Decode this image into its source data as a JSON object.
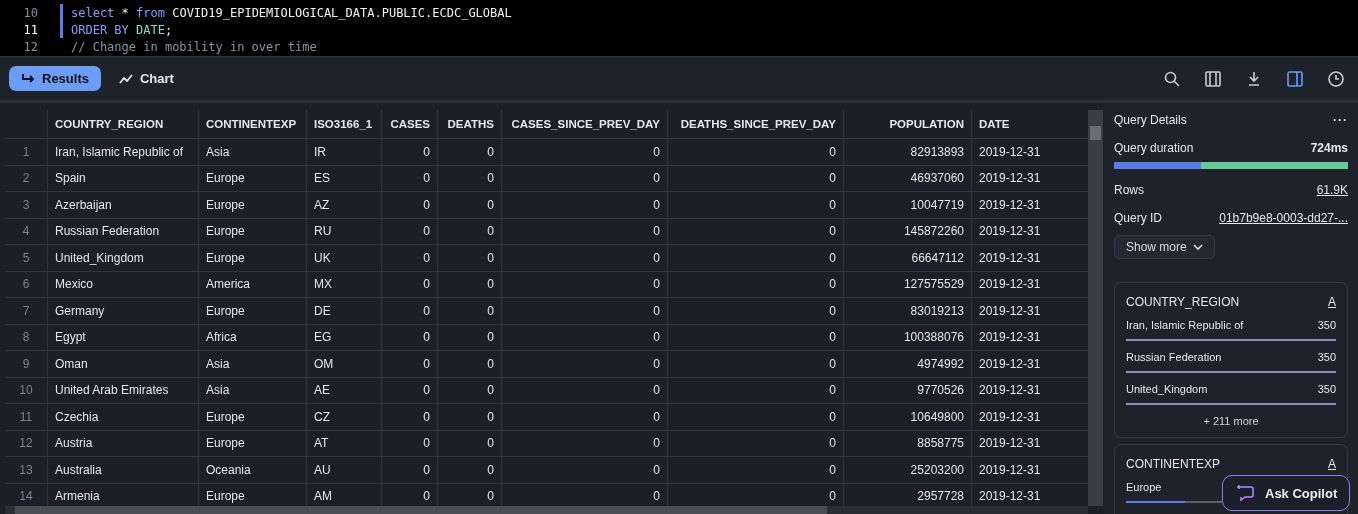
{
  "editor": {
    "lines": [
      {
        "number": "10",
        "current": false,
        "tokens": [
          {
            "kind": "kw",
            "text": "select"
          },
          {
            "kind": "op",
            "text": " * "
          },
          {
            "kind": "kw",
            "text": "from"
          },
          {
            "kind": "id",
            "text": " COVID19_EPIDEMIOLOGICAL_DATA.PUBLIC.ECDC_GLOBAL"
          }
        ]
      },
      {
        "number": "11",
        "current": true,
        "tokens": [
          {
            "kind": "kw",
            "text": "ORDER BY "
          },
          {
            "kind": "fn",
            "text": "DATE"
          },
          {
            "kind": "id",
            "text": ";"
          }
        ]
      },
      {
        "number": "12",
        "current": false,
        "tokens": [
          {
            "kind": "comment",
            "text": "// Change in mobility in over time"
          }
        ]
      }
    ]
  },
  "tabs": [
    {
      "label": "Results",
      "selected": true
    },
    {
      "label": "Chart",
      "selected": false
    }
  ],
  "toolbar": [
    {
      "kind": "search",
      "selected": false
    },
    {
      "kind": "columns",
      "selected": false
    },
    {
      "kind": "download",
      "selected": false
    },
    {
      "kind": "panel",
      "selected": true
    },
    {
      "kind": "history",
      "selected": false
    }
  ],
  "table": {
    "columns": [
      "COUNTRY_REGION",
      "CONTINENTEXP",
      "ISO3166_1",
      "CASES",
      "DEATHS",
      "CASES_SINCE_PREV_DAY",
      "DEATHS_SINCE_PREV_DAY",
      "POPULATION",
      "DATE"
    ],
    "rows": [
      {
        "number": "1",
        "cells": [
          "Iran, Islamic Republic of",
          "Asia",
          "IR",
          "0",
          "0",
          "0",
          "0",
          "82913893",
          "2019-12-31"
        ]
      },
      {
        "number": "2",
        "cells": [
          "Spain",
          "Europe",
          "ES",
          "0",
          "0",
          "0",
          "0",
          "46937060",
          "2019-12-31"
        ]
      },
      {
        "number": "3",
        "cells": [
          "Azerbaijan",
          "Europe",
          "AZ",
          "0",
          "0",
          "0",
          "0",
          "10047719",
          "2019-12-31"
        ]
      },
      {
        "number": "4",
        "cells": [
          "Russian Federation",
          "Europe",
          "RU",
          "0",
          "0",
          "0",
          "0",
          "145872260",
          "2019-12-31"
        ]
      },
      {
        "number": "5",
        "cells": [
          "United_Kingdom",
          "Europe",
          "UK",
          "0",
          "0",
          "0",
          "0",
          "66647112",
          "2019-12-31"
        ]
      },
      {
        "number": "6",
        "cells": [
          "Mexico",
          "America",
          "MX",
          "0",
          "0",
          "0",
          "0",
          "127575529",
          "2019-12-31"
        ]
      },
      {
        "number": "7",
        "cells": [
          "Germany",
          "Europe",
          "DE",
          "0",
          "0",
          "0",
          "0",
          "83019213",
          "2019-12-31"
        ]
      },
      {
        "number": "8",
        "cells": [
          "Egypt",
          "Africa",
          "EG",
          "0",
          "0",
          "0",
          "0",
          "100388076",
          "2019-12-31"
        ]
      },
      {
        "number": "9",
        "cells": [
          "Oman",
          "Asia",
          "OM",
          "0",
          "0",
          "0",
          "0",
          "4974992",
          "2019-12-31"
        ]
      },
      {
        "number": "10",
        "cells": [
          "United Arab Emirates",
          "Asia",
          "AE",
          "0",
          "0",
          "0",
          "0",
          "9770526",
          "2019-12-31"
        ]
      },
      {
        "number": "11",
        "cells": [
          "Czechia",
          "Europe",
          "CZ",
          "0",
          "0",
          "0",
          "0",
          "10649800",
          "2019-12-31"
        ]
      },
      {
        "number": "12",
        "cells": [
          "Austria",
          "Europe",
          "AT",
          "0",
          "0",
          "0",
          "0",
          "8858775",
          "2019-12-31"
        ]
      },
      {
        "number": "13",
        "cells": [
          "Australia",
          "Oceania",
          "AU",
          "0",
          "0",
          "0",
          "0",
          "25203200",
          "2019-12-31"
        ]
      },
      {
        "number": "14",
        "cells": [
          "Armenia",
          "Europe",
          "AM",
          "0",
          "0",
          "0",
          "0",
          "2957728",
          "2019-12-31"
        ]
      }
    ]
  },
  "details": {
    "title": "Query Details",
    "menu": "···",
    "duration_label": "Query duration",
    "duration": "724ms",
    "level": 0.37,
    "rows_label": "Rows",
    "rows": "61.9K",
    "id_label": "Query ID",
    "id": "01b7b9e8-0003-dd27-...",
    "show_more": "Show more"
  },
  "summaries": [
    {
      "column": "COUNTRY_REGION",
      "type_mark": "A",
      "items": [
        {
          "label": "Iran, Islamic Republic of",
          "count": "350",
          "level": 1
        },
        {
          "label": "Russian Federation",
          "count": "350",
          "level": 1
        },
        {
          "label": "United_Kingdom",
          "count": "350",
          "level": 1
        }
      ],
      "more": "+ 211 more"
    },
    {
      "column": "CONTINENTEXP",
      "type_mark": "A",
      "items": [
        {
          "label": "Europe",
          "level": 0.28
        }
      ]
    }
  ],
  "copilot": "Ask Copilot"
}
